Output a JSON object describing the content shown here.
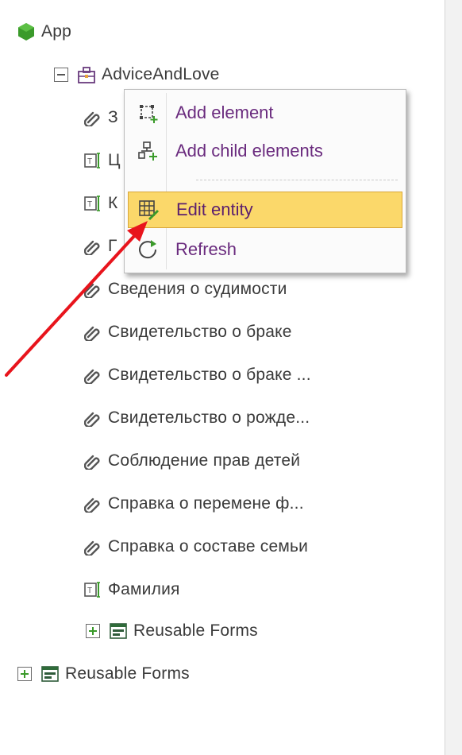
{
  "tree": {
    "root": {
      "label": "App",
      "icon": "hexagon-icon"
    },
    "entity": {
      "label": "AdviceAndLove",
      "icon": "entity-icon"
    },
    "children": [
      {
        "label": "З",
        "icon": "attachment-icon"
      },
      {
        "label": "Ц",
        "icon": "text-field-icon"
      },
      {
        "label": "К",
        "icon": "text-field-icon"
      },
      {
        "label": "Г",
        "icon": "attachment-icon"
      },
      {
        "label": "Сведения о судимости",
        "icon": "attachment-icon"
      },
      {
        "label": "Свидетельство о браке",
        "icon": "attachment-icon"
      },
      {
        "label": "Свидетельство о браке ...",
        "icon": "attachment-icon"
      },
      {
        "label": "Свидетельство о рожде...",
        "icon": "attachment-icon"
      },
      {
        "label": "Соблюдение прав детей",
        "icon": "attachment-icon"
      },
      {
        "label": "Справка о перемене ф...",
        "icon": "attachment-icon"
      },
      {
        "label": "Справка о составе семьи",
        "icon": "attachment-icon"
      },
      {
        "label": "Фамилия",
        "icon": "text-field-icon"
      }
    ],
    "nested_forms": {
      "label": "Reusable Forms",
      "icon": "forms-icon"
    },
    "root_forms": {
      "label": "Reusable Forms",
      "icon": "forms-icon"
    }
  },
  "context_menu": {
    "items": [
      {
        "label": "Add element",
        "icon": "add-element-icon",
        "highlighted": false
      },
      {
        "label": "Add child elements",
        "icon": "add-child-elements-icon",
        "highlighted": false
      },
      {
        "label": "Edit entity",
        "icon": "edit-entity-icon",
        "highlighted": true
      },
      {
        "label": "Refresh",
        "icon": "refresh-icon",
        "highlighted": false
      }
    ]
  },
  "colors": {
    "menu_label": "#6a2b7e",
    "highlight_bg": "#fbd86a",
    "highlight_border": "#d9a63a",
    "arrow": "#e8141c",
    "root_icon": "#3a9a2a"
  }
}
